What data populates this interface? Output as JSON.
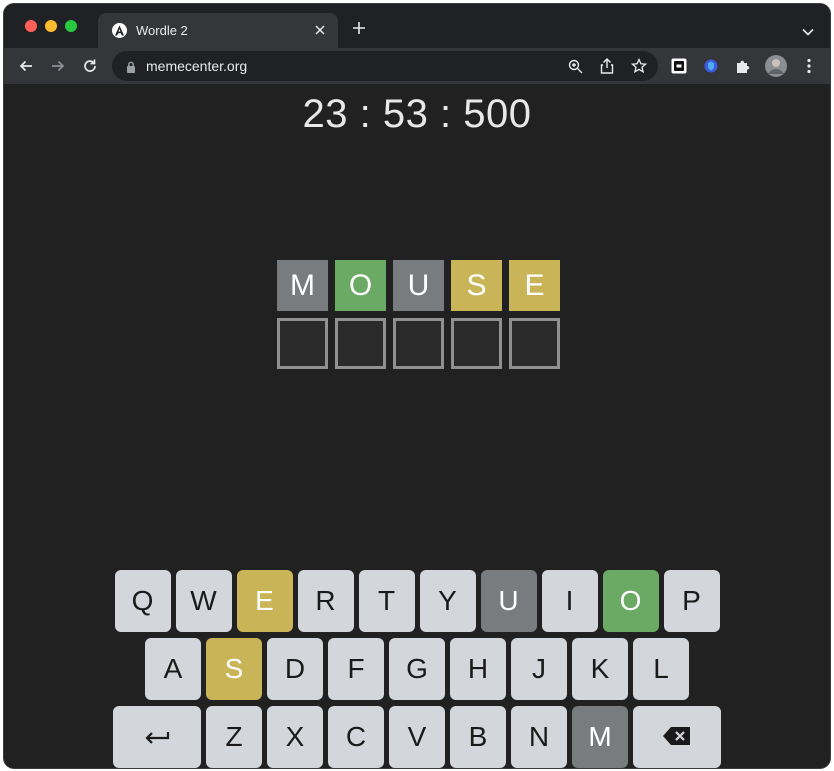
{
  "browser": {
    "tab_title": "Wordle 2",
    "url": "memecenter.org"
  },
  "game": {
    "timer": "23 : 53 : 500",
    "guess_rows": [
      {
        "tiles": [
          {
            "letter": "M",
            "state": "gray"
          },
          {
            "letter": "O",
            "state": "green"
          },
          {
            "letter": "U",
            "state": "gray"
          },
          {
            "letter": "S",
            "state": "yellow"
          },
          {
            "letter": "E",
            "state": "yellow"
          }
        ]
      },
      {
        "tiles": [
          {
            "letter": "",
            "state": "empty"
          },
          {
            "letter": "",
            "state": "empty"
          },
          {
            "letter": "",
            "state": "empty"
          },
          {
            "letter": "",
            "state": "empty"
          },
          {
            "letter": "",
            "state": "empty"
          }
        ]
      }
    ]
  },
  "keyboard": {
    "row1": [
      {
        "label": "Q",
        "state": "default"
      },
      {
        "label": "W",
        "state": "default"
      },
      {
        "label": "E",
        "state": "yellow"
      },
      {
        "label": "R",
        "state": "default"
      },
      {
        "label": "T",
        "state": "default"
      },
      {
        "label": "Y",
        "state": "default"
      },
      {
        "label": "U",
        "state": "gray"
      },
      {
        "label": "I",
        "state": "default"
      },
      {
        "label": "O",
        "state": "green"
      },
      {
        "label": "P",
        "state": "default"
      }
    ],
    "row2": [
      {
        "label": "A",
        "state": "default"
      },
      {
        "label": "S",
        "state": "yellow"
      },
      {
        "label": "D",
        "state": "default"
      },
      {
        "label": "F",
        "state": "default"
      },
      {
        "label": "G",
        "state": "default"
      },
      {
        "label": "H",
        "state": "default"
      },
      {
        "label": "J",
        "state": "default"
      },
      {
        "label": "K",
        "state": "default"
      },
      {
        "label": "L",
        "state": "default"
      }
    ],
    "row3": [
      {
        "label": "Z",
        "state": "default"
      },
      {
        "label": "X",
        "state": "default"
      },
      {
        "label": "C",
        "state": "default"
      },
      {
        "label": "V",
        "state": "default"
      },
      {
        "label": "B",
        "state": "default"
      },
      {
        "label": "N",
        "state": "default"
      },
      {
        "label": "M",
        "state": "gray"
      }
    ],
    "enter_icon": "enter-arrow-icon",
    "backspace_icon": "backspace-icon"
  },
  "colors": {
    "correct": "#6aaa64",
    "present": "#c9b458",
    "absent": "#787c7e",
    "key_default": "#d3d6da",
    "page_background": "#212121"
  }
}
